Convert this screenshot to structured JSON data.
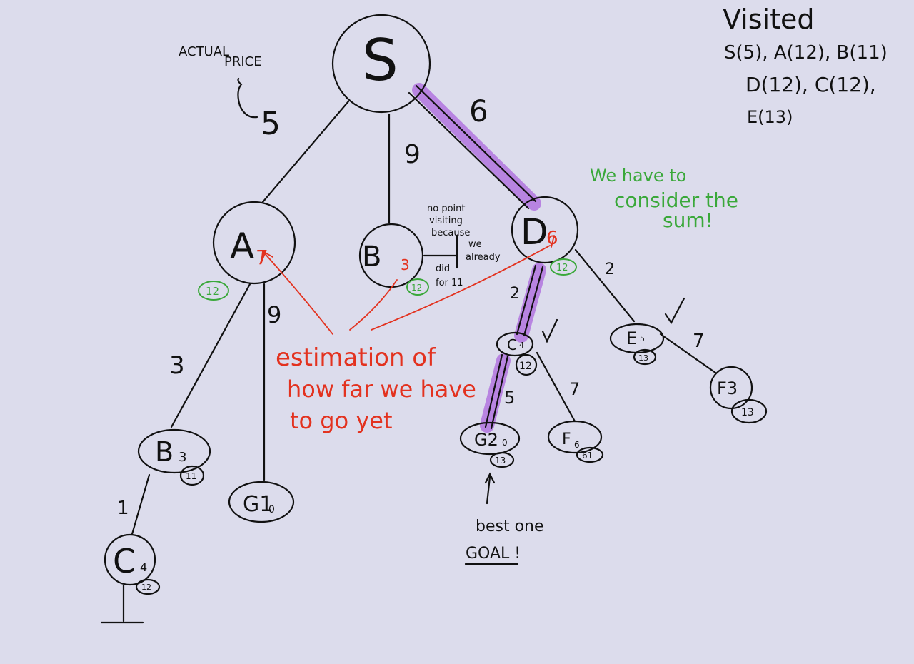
{
  "visited": {
    "title": "Visited",
    "line1": "S(5), A(12), B(11)",
    "line2": "D(12), C(12),",
    "line3": "E(13)"
  },
  "actual_price": {
    "label_line1": "ACTUAL",
    "label_line2": "PRICE",
    "value": "5"
  },
  "nodes": {
    "S": "S",
    "A": {
      "letter": "A",
      "h": "7",
      "sum": "12"
    },
    "B": {
      "letter": "B",
      "h": "3",
      "sum": "12"
    },
    "D": {
      "letter": "D",
      "h": "6",
      "sum": "12"
    },
    "C1": {
      "label": "C",
      "h": "4",
      "sum": "12"
    },
    "E1": {
      "label": "E",
      "h": "5",
      "sum": "13"
    },
    "F1": {
      "label": "F3",
      "sum": "13"
    },
    "G2": {
      "label": "G2",
      "h": "0",
      "sum": "13"
    },
    "F2": {
      "label": "F",
      "h": "6",
      "sum": "61"
    },
    "B2": {
      "label": "B",
      "h": "3",
      "sum": "11"
    },
    "G1": {
      "label": "G1",
      "h": "0"
    },
    "C2": {
      "label": "C",
      "h": "4",
      "sum": "12"
    }
  },
  "edges": {
    "S_B": "9",
    "S_D": "6",
    "A_B2": "3",
    "A_G1": "9",
    "B2_C2": "1",
    "D_C1": "2",
    "D_E1": "2",
    "C1_G2": "5",
    "C1_F2": "7",
    "E1_F1": "7"
  },
  "notes": {
    "b_note": [
      "no point",
      "visiting",
      "because",
      "we",
      "already",
      "did",
      "for 11"
    ],
    "estimation": [
      "estimation of",
      "how far we have",
      "to go yet"
    ],
    "green": [
      "We have to",
      "consider the",
      "sum!"
    ],
    "best": "best one",
    "goal": "GOAL !"
  },
  "colors": {
    "ink": "#111111",
    "heuristic": "#e3321f",
    "sum_note": "#3aa83a",
    "best_path": "#b57ee0",
    "background": "#dcdcec"
  }
}
